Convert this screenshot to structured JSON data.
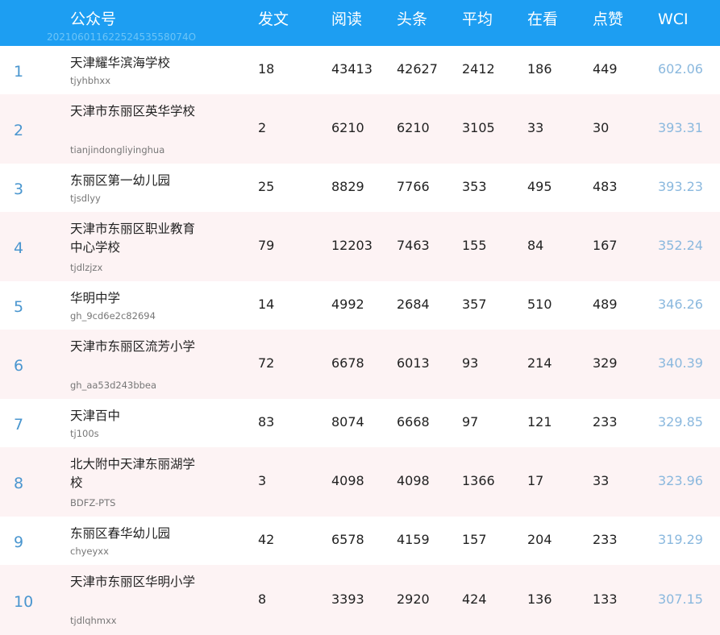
{
  "header": {
    "name_col": "公众号",
    "id_text": "20210601162252453558074O",
    "cols": [
      "发文",
      "阅读",
      "头条",
      "平均",
      "在看",
      "点赞",
      "WCI"
    ]
  },
  "rows": [
    {
      "rank": "1",
      "name": "天津耀华滨海学校",
      "account": "tjyhbhxx",
      "posts": "18",
      "reads": "43413",
      "headline": "42627",
      "avg": "2412",
      "watching": "186",
      "likes": "449",
      "wci": "602.06"
    },
    {
      "rank": "2",
      "name": "天津市东丽区英华学校",
      "account": "tianjindongliyinghua",
      "posts": "2",
      "reads": "6210",
      "headline": "6210",
      "avg": "3105",
      "watching": "33",
      "likes": "30",
      "wci": "393.31"
    },
    {
      "rank": "3",
      "name": "东丽区第一幼儿园",
      "account": "tjsdlyy",
      "posts": "25",
      "reads": "8829",
      "headline": "7766",
      "avg": "353",
      "watching": "495",
      "likes": "483",
      "wci": "393.23"
    },
    {
      "rank": "4",
      "name": "天津市东丽区职业教育中心学校",
      "account": "tjdlzjzx",
      "posts": "79",
      "reads": "12203",
      "headline": "7463",
      "avg": "155",
      "watching": "84",
      "likes": "167",
      "wci": "352.24"
    },
    {
      "rank": "5",
      "name": "华明中学",
      "account": "gh_9cd6e2c82694",
      "posts": "14",
      "reads": "4992",
      "headline": "2684",
      "avg": "357",
      "watching": "510",
      "likes": "489",
      "wci": "346.26"
    },
    {
      "rank": "6",
      "name": "天津市东丽区流芳小学",
      "account": "gh_aa53d243bbea",
      "posts": "72",
      "reads": "6678",
      "headline": "6013",
      "avg": "93",
      "watching": "214",
      "likes": "329",
      "wci": "340.39"
    },
    {
      "rank": "7",
      "name": "天津百中",
      "account": "tj100s",
      "posts": "83",
      "reads": "8074",
      "headline": "6668",
      "avg": "97",
      "watching": "121",
      "likes": "233",
      "wci": "329.85"
    },
    {
      "rank": "8",
      "name": "北大附中天津东丽湖学校",
      "account": "BDFZ-PTS",
      "posts": "3",
      "reads": "4098",
      "headline": "4098",
      "avg": "1366",
      "watching": "17",
      "likes": "33",
      "wci": "323.96"
    },
    {
      "rank": "9",
      "name": "东丽区春华幼儿园",
      "account": "chyeyxx",
      "posts": "42",
      "reads": "6578",
      "headline": "4159",
      "avg": "157",
      "watching": "204",
      "likes": "233",
      "wci": "319.29"
    },
    {
      "rank": "10",
      "name": "天津市东丽区华明小学",
      "account": "tjdlqhmxx",
      "posts": "8",
      "reads": "3393",
      "headline": "2920",
      "avg": "424",
      "watching": "136",
      "likes": "133",
      "wci": "307.15"
    }
  ],
  "colors": {
    "header_bg": "#1d9ef2",
    "alt_row_bg": "#fdf3f4",
    "rank": "#4a96cf",
    "wci": "#8ab8de"
  }
}
